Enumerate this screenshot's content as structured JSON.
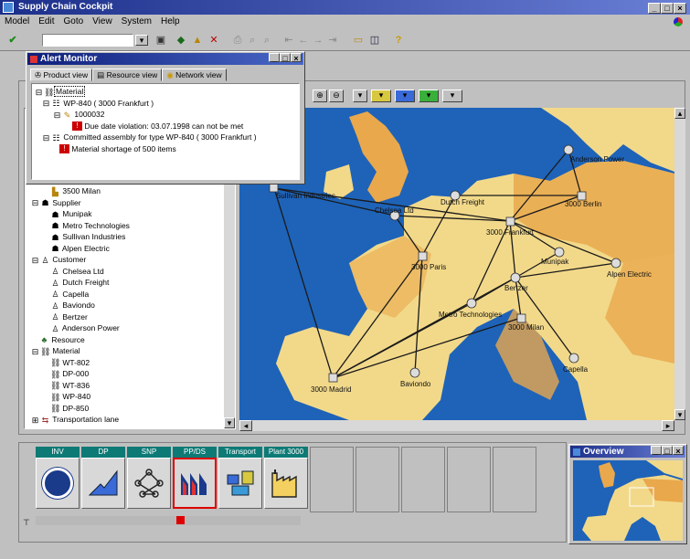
{
  "app": {
    "title": "Supply Chain Cockpit",
    "window_buttons": [
      "_",
      "□",
      "×"
    ]
  },
  "menu": [
    "Model",
    "Edit",
    "Goto",
    "View",
    "System",
    "Help"
  ],
  "alert_monitor": {
    "title": "Alert Monitor",
    "tabs": [
      "Product view",
      "Resource view",
      "Network view"
    ],
    "rows": [
      "Material",
      "WP-840 ( 3000 Frankfurt )",
      "1000032",
      "Due date violation: 03.07.1998 can not be met",
      "Committed assembly for type WP-840 ( 3000 Frankfurt )",
      "Material shortage of 500 items"
    ]
  },
  "tree": {
    "items": [
      "3500 Milan",
      "Supplier",
      "Munipak",
      "Metro Technologies",
      "Sullivan Industries",
      "Alpen Electric",
      "Customer",
      "Chelsea Ltd",
      "Dutch Freight",
      "Capella",
      "Baviondo",
      "Bertzer",
      "Anderson Power",
      "Resource",
      "Material",
      "WT-802",
      "DP-000",
      "WT-836",
      "WP-840",
      "DP-850",
      "Transportation lane"
    ]
  },
  "map": {
    "labels": [
      "Anderson Power",
      "Sullivan Industries",
      "Dutch Freight",
      "3000 Berlin",
      "3000 Frankfurt",
      "3000 Paris",
      "Munipak",
      "Alpen Electric",
      "Bertzer",
      "Metro Technologies",
      "3000 Milan",
      "Capella",
      "3000 Madrid",
      "Baviondo",
      "Chelsea Ltd"
    ],
    "colors": {
      "sea": "#1e63b8",
      "land_light": "#f2d98a",
      "land_dark": "#e9a84c",
      "route": "#1a1a1a"
    }
  },
  "planning_tiles": [
    {
      "label": "INV",
      "icon": "inventory-icon"
    },
    {
      "label": "DP",
      "icon": "demand-planning-icon"
    },
    {
      "label": "SNP",
      "icon": "network-planning-icon"
    },
    {
      "label": "PP/DS",
      "icon": "production-scheduling-icon"
    },
    {
      "label": "Transport",
      "icon": "transport-icon"
    },
    {
      "label": "Plant 3000",
      "icon": "plant-icon"
    }
  ],
  "overview": {
    "title": "Overview"
  }
}
